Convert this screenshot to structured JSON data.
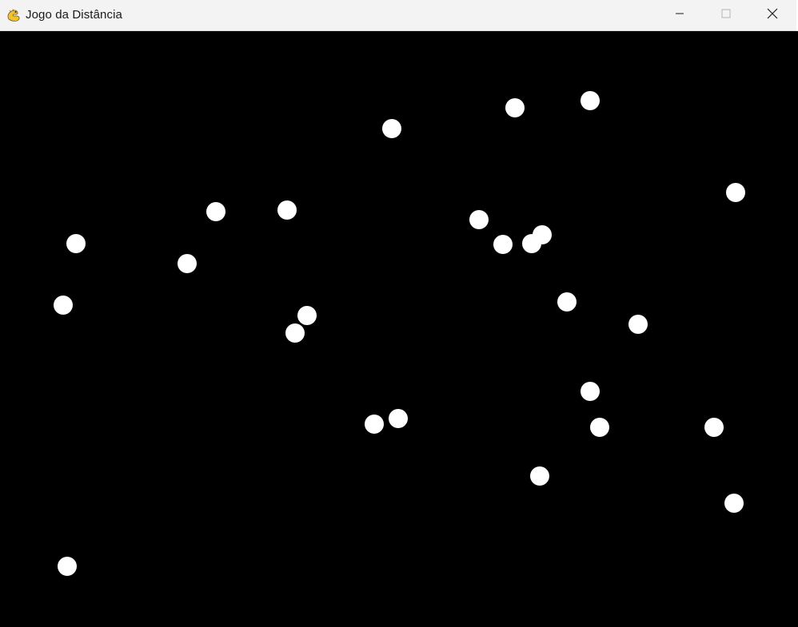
{
  "window": {
    "title": "Jogo da Distância",
    "icon": "pygame-snake-icon",
    "controls": {
      "minimize_icon": "minimize-icon",
      "maximize_icon": "maximize-icon",
      "close_icon": "close-icon"
    }
  },
  "game": {
    "background_color": "#000000",
    "dot_color": "#ffffff"
  }
}
